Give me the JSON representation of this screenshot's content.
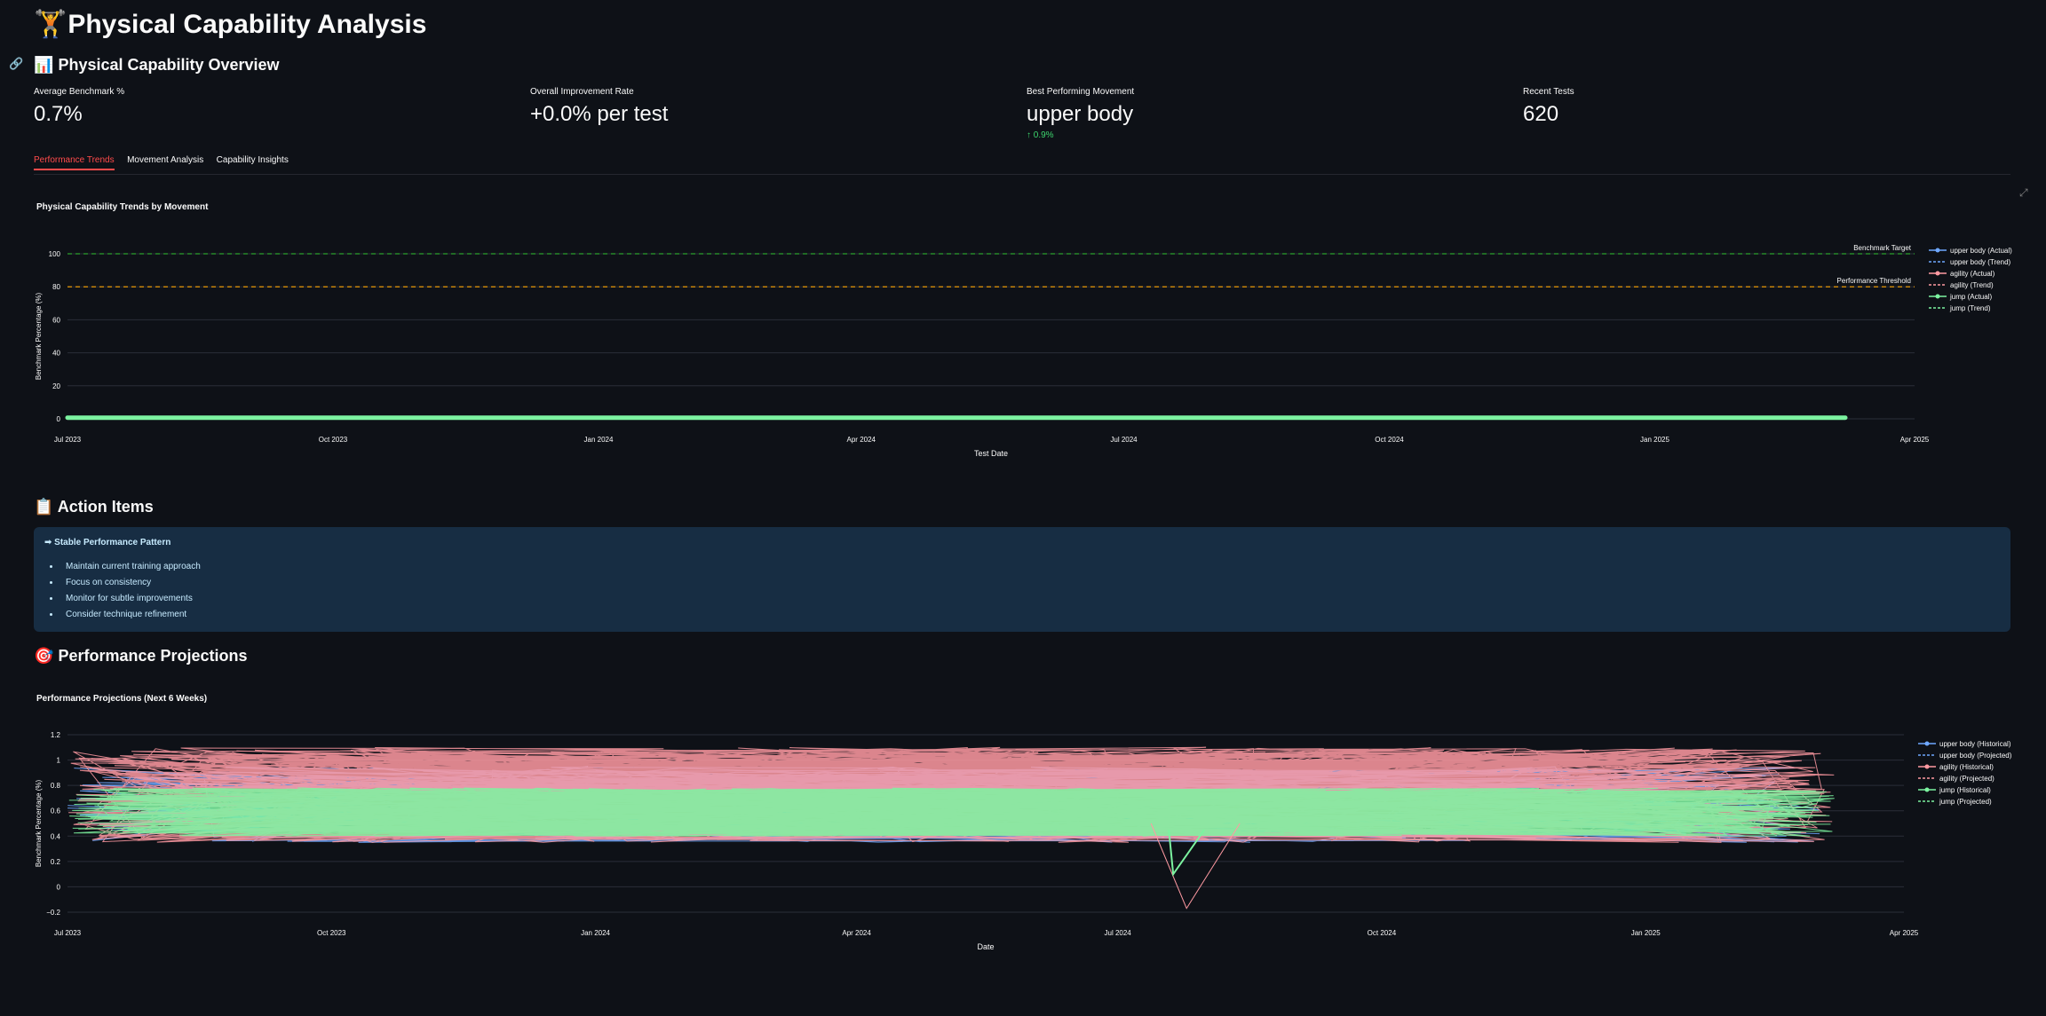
{
  "app": {
    "title": "Physical Capability Analysis",
    "title_emoji": "🏋"
  },
  "overview": {
    "heading": "Physical Capability Overview",
    "heading_emoji": "📊",
    "metrics": [
      {
        "label": "Average Benchmark %",
        "value": "0.7%"
      },
      {
        "label": "Overall Improvement Rate",
        "value": "+0.0% per test"
      },
      {
        "label": "Best Performing Movement",
        "value": "upper body",
        "delta": "↑ 0.9%"
      },
      {
        "label": "Recent Tests",
        "value": "620"
      }
    ]
  },
  "tabs": [
    "Performance Trends",
    "Movement Analysis",
    "Capability Insights"
  ],
  "active_tab": 0,
  "trends_chart": {
    "chart_data": {
      "type": "line",
      "title": "Physical Capability Trends by Movement",
      "xlabel": "Test Date",
      "ylabel": "Benchmark Percentage (%)",
      "ylim": [
        0,
        100
      ],
      "y_ticks": [
        "0",
        "20",
        "40",
        "60",
        "80",
        "100"
      ],
      "x_ticks": [
        "Jul 2023",
        "Oct 2023",
        "Jan 2024",
        "Apr 2024",
        "Jul 2024",
        "Oct 2024",
        "Jan 2025",
        "Apr 2025"
      ],
      "x_range": [
        "2023-07-01",
        "2025-04-01"
      ],
      "reference_lines": [
        {
          "label": "Benchmark Target",
          "y": 100,
          "color": "#2ca02c"
        },
        {
          "label": "Performance Threshold",
          "y": 80,
          "color": "#ffa500"
        }
      ],
      "data_x_range": [
        "2023-07-01",
        "2025-03-08"
      ],
      "series_level": 0.7,
      "legend": [
        "upper body (Actual)",
        "upper body (Trend)",
        "agility (Actual)",
        "agility (Trend)",
        "jump (Actual)",
        "jump (Trend)"
      ],
      "legend_position": "right",
      "grid": true
    }
  },
  "action_items": {
    "heading": "Action Items",
    "heading_emoji": "📋",
    "alert_title": "➡ Stable Performance Pattern",
    "items": [
      "Maintain current training approach",
      "Focus on consistency",
      "Monitor for subtle improvements",
      "Consider technique refinement"
    ]
  },
  "projections": {
    "heading": "Performance Projections",
    "heading_emoji": "🎯",
    "chart_data": {
      "type": "line",
      "title": "Performance Projections (Next 6 Weeks)",
      "xlabel": "Date",
      "ylabel": "Benchmark Percentage (%)",
      "ylim": [
        -0.2,
        1.2
      ],
      "y_ticks": [
        "−0.2",
        "0",
        "0.2",
        "0.4",
        "0.6",
        "0.8",
        "1",
        "1.2"
      ],
      "x_ticks": [
        "Jul 2023",
        "Oct 2023",
        "Jan 2024",
        "Apr 2024",
        "Jul 2024",
        "Oct 2024",
        "Jan 2025",
        "Apr 2025"
      ],
      "x_range": [
        "2023-07-01",
        "2025-04-01"
      ],
      "legend": [
        "upper body (Historical)",
        "upper body (Projected)",
        "agility (Historical)",
        "agility (Projected)",
        "jump (Historical)",
        "jump (Projected)"
      ],
      "legend_position": "right",
      "grid": true
    }
  },
  "colors": {
    "background": "#0e1117",
    "accent": "#ff4b4b",
    "upper_body": "#6fa8ff",
    "agility": "#ff9aa2",
    "jump": "#7cf3a0"
  }
}
